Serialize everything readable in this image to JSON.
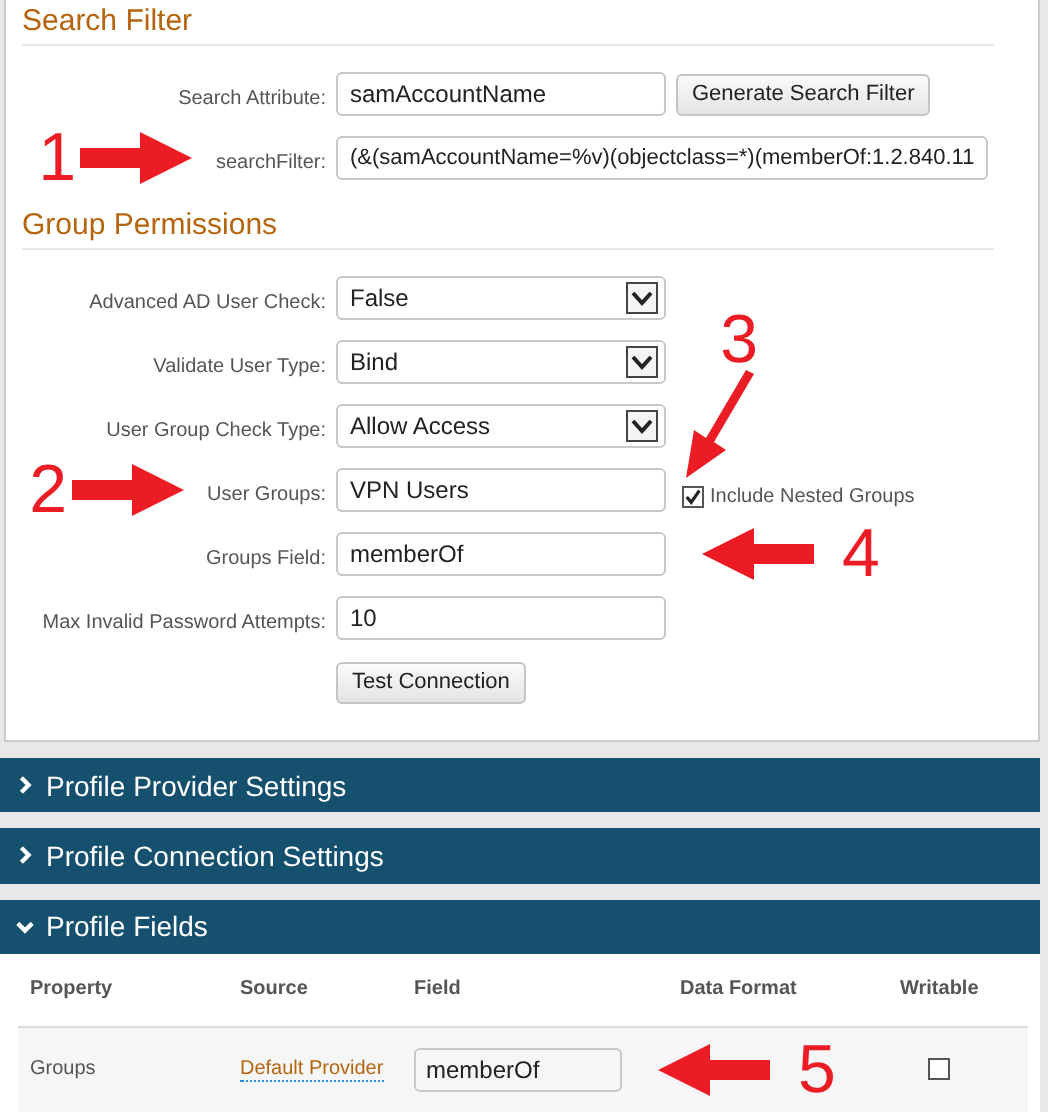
{
  "sections": [
    {
      "title": "Search Filter",
      "rows": [
        {
          "kind": "input",
          "label": "Search Attribute:",
          "value": "samAccountName",
          "button": "Generate Search Filter"
        },
        {
          "kind": "wide-input",
          "label": "searchFilter:",
          "value": "(&(samAccountName=%v)(objectclass=*)(memberOf:1.2.840.11",
          "annotation": {
            "number": "1",
            "kind": "right"
          }
        }
      ]
    },
    {
      "title": "Group Permissions",
      "rows": [
        {
          "kind": "select",
          "label": "Advanced AD User Check:",
          "value": "False"
        },
        {
          "kind": "select",
          "label": "Validate User Type:",
          "value": "Bind"
        },
        {
          "kind": "select",
          "label": "User Group Check Type:",
          "value": "Allow Access"
        },
        {
          "kind": "input",
          "label": "User Groups:",
          "value": "VPN Users",
          "annotation": {
            "number": "2",
            "kind": "right"
          },
          "checkbox": {
            "label": "Include Nested Groups",
            "checked": true,
            "annotation": {
              "number": "3",
              "kind": "down-left"
            }
          }
        },
        {
          "kind": "input",
          "label": "Groups Field:",
          "value": "memberOf",
          "annotation": {
            "number": "4",
            "kind": "left"
          }
        },
        {
          "kind": "input",
          "label": "Max Invalid Password Attempts:",
          "value": "10"
        },
        {
          "kind": "button",
          "label": "Test Connection"
        }
      ]
    }
  ],
  "panels": [
    {
      "title": "Profile Provider Settings",
      "expanded": false
    },
    {
      "title": "Profile Connection Settings",
      "expanded": false
    },
    {
      "title": "Profile Fields",
      "expanded": true,
      "table": {
        "columns": [
          "Property",
          "Source",
          "Field",
          "Data Format",
          "Writable"
        ],
        "rows": [
          {
            "property": "Groups",
            "source": "Default Provider",
            "field": "memberOf",
            "writable": false,
            "annotation": {
              "number": "5",
              "kind": "left"
            }
          }
        ]
      }
    }
  ]
}
